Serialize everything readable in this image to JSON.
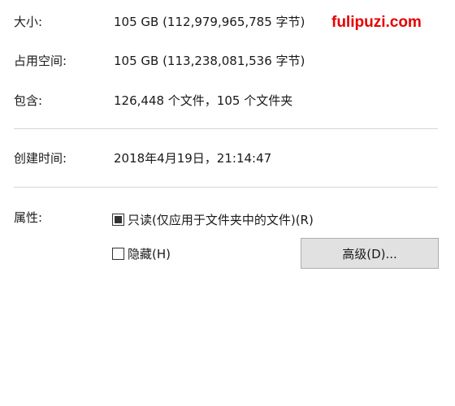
{
  "watermark": "fulipuzi.com",
  "properties": {
    "size": {
      "label": "大小:",
      "value": "105 GB (112,979,965,785 字节)"
    },
    "size_on_disk": {
      "label": "占用空间:",
      "value": "105 GB (113,238,081,536 字节)"
    },
    "contains": {
      "label": "包含:",
      "value": "126,448 个文件，105 个文件夹"
    },
    "created": {
      "label": "创建时间:",
      "value": "2018年4月19日，21:14:47"
    }
  },
  "attributes": {
    "label": "属性:",
    "readonly": {
      "label": "只读(仅应用于文件夹中的文件)(R)",
      "state": "indeterminate"
    },
    "hidden": {
      "label": "隐藏(H)",
      "state": "unchecked"
    },
    "advanced_button": "高级(D)..."
  }
}
